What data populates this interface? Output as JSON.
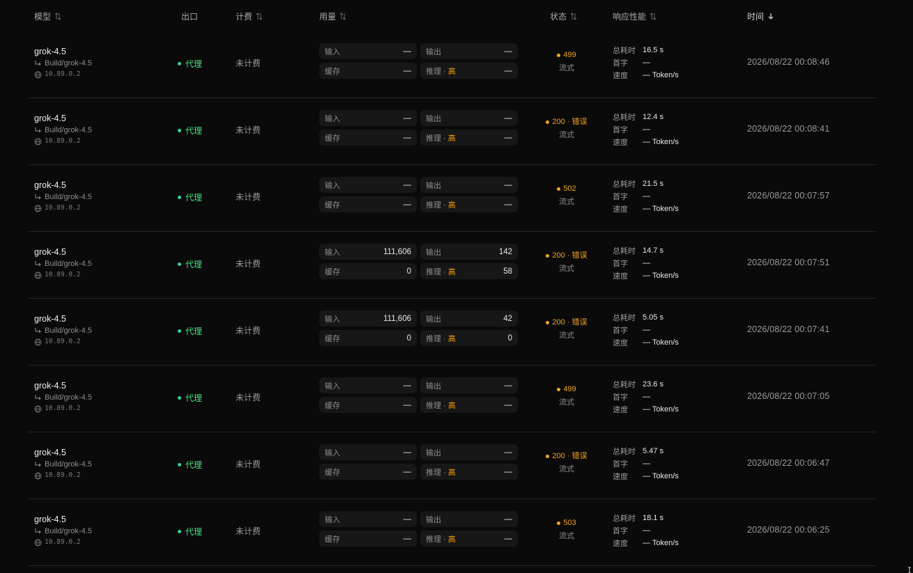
{
  "header": {
    "model": "模型",
    "exit": "出口",
    "billing": "计费",
    "usage": "用量",
    "status": "状态",
    "perf": "响应性能",
    "time": "时间"
  },
  "usage_labels": {
    "input": "输入",
    "output": "输出",
    "cache": "缓存",
    "reasoning_prefix": "推理",
    "reasoning_sep": " · ",
    "reasoning_level": "高"
  },
  "perf_labels": {
    "total": "总耗时",
    "first": "首字",
    "speed": "速度"
  },
  "rows": [
    {
      "model": "grok-4.5",
      "route": "Build/grok-4.5",
      "ip": "10.89.0.2",
      "exit": "代理",
      "billing": "未计费",
      "input": "—",
      "output": "—",
      "cache": "—",
      "reasoning": "—",
      "status": "499",
      "status_sub": "流式",
      "total": "16.5 s",
      "first": "—",
      "speed": "— Token/s",
      "time": "2026/08/22 00:08:46"
    },
    {
      "model": "grok-4.5",
      "route": "Build/grok-4.5",
      "ip": "10.89.0.2",
      "exit": "代理",
      "billing": "未计费",
      "input": "—",
      "output": "—",
      "cache": "—",
      "reasoning": "—",
      "status": "200 · 错误",
      "status_sub": "流式",
      "total": "12.4 s",
      "first": "—",
      "speed": "— Token/s",
      "time": "2026/08/22 00:08:41"
    },
    {
      "model": "grok-4.5",
      "route": "Build/grok-4.5",
      "ip": "10.89.0.2",
      "exit": "代理",
      "billing": "未计费",
      "input": "—",
      "output": "—",
      "cache": "—",
      "reasoning": "—",
      "status": "502",
      "status_sub": "流式",
      "total": "21.5 s",
      "first": "—",
      "speed": "— Token/s",
      "time": "2026/08/22 00:07:57"
    },
    {
      "model": "grok-4.5",
      "route": "Build/grok-4.5",
      "ip": "10.89.0.2",
      "exit": "代理",
      "billing": "未计费",
      "input": "111,606",
      "output": "142",
      "cache": "0",
      "reasoning": "58",
      "status": "200 · 错误",
      "status_sub": "流式",
      "total": "14.7 s",
      "first": "—",
      "speed": "— Token/s",
      "time": "2026/08/22 00:07:51"
    },
    {
      "model": "grok-4.5",
      "route": "Build/grok-4.5",
      "ip": "10.89.0.2",
      "exit": "代理",
      "billing": "未计费",
      "input": "111,606",
      "output": "42",
      "cache": "0",
      "reasoning": "0",
      "status": "200 · 错误",
      "status_sub": "流式",
      "total": "5.05 s",
      "first": "—",
      "speed": "— Token/s",
      "time": "2026/08/22 00:07:41"
    },
    {
      "model": "grok-4.5",
      "route": "Build/grok-4.5",
      "ip": "10.89.0.2",
      "exit": "代理",
      "billing": "未计费",
      "input": "—",
      "output": "—",
      "cache": "—",
      "reasoning": "—",
      "status": "499",
      "status_sub": "流式",
      "total": "23.6 s",
      "first": "—",
      "speed": "— Token/s",
      "time": "2026/08/22 00:07:05"
    },
    {
      "model": "grok-4.5",
      "route": "Build/grok-4.5",
      "ip": "10.89.0.2",
      "exit": "代理",
      "billing": "未计费",
      "input": "—",
      "output": "—",
      "cache": "—",
      "reasoning": "—",
      "status": "200 · 错误",
      "status_sub": "流式",
      "total": "5.47 s",
      "first": "—",
      "speed": "— Token/s",
      "time": "2026/08/22 00:06:47"
    },
    {
      "model": "grok-4.5",
      "route": "Build/grok-4.5",
      "ip": "10.89.0.2",
      "exit": "代理",
      "billing": "未计费",
      "input": "—",
      "output": "—",
      "cache": "—",
      "reasoning": "—",
      "status": "503",
      "status_sub": "流式",
      "total": "18.1 s",
      "first": "—",
      "speed": "— Token/s",
      "time": "2026/08/22 00:06:25"
    }
  ]
}
